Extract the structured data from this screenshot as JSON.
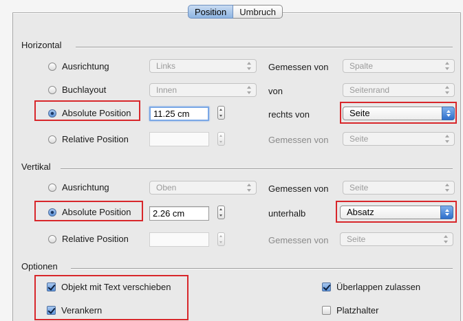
{
  "tabs": [
    {
      "label": "Position",
      "active": true
    },
    {
      "label": "Umbruch",
      "active": false
    }
  ],
  "horizontal": {
    "title": "Horizontal",
    "rows": [
      {
        "radio": "Ausrichtung",
        "selected": false,
        "value": "Links",
        "relation_label": "Gemessen von",
        "relation_value": "Spalte"
      },
      {
        "radio": "Buchlayout",
        "selected": false,
        "value": "Innen",
        "relation_label": "von",
        "relation_value": "Seitenrand"
      },
      {
        "radio": "Absolute Position",
        "selected": true,
        "value": "11.25 cm",
        "relation_label": "rechts von",
        "relation_value": "Seite"
      },
      {
        "radio": "Relative Position",
        "selected": false,
        "value": "",
        "relation_label": "Gemessen von",
        "relation_value": "Seite"
      }
    ]
  },
  "vertikal": {
    "title": "Vertikal",
    "rows": [
      {
        "radio": "Ausrichtung",
        "selected": false,
        "value": "Oben",
        "relation_label": "Gemessen von",
        "relation_value": "Seite"
      },
      {
        "radio": "Absolute Position",
        "selected": true,
        "value": "2.26 cm",
        "relation_label": "unterhalb",
        "relation_value": "Absatz"
      },
      {
        "radio": "Relative Position",
        "selected": false,
        "value": "",
        "relation_label": "Gemessen von",
        "relation_value": "Seite"
      }
    ]
  },
  "optionen": {
    "title": "Optionen",
    "checkboxes": [
      {
        "label": "Objekt mit Text verschieben",
        "checked": true
      },
      {
        "label": "Verankern",
        "checked": true
      },
      {
        "label": "Überlappen zulassen",
        "checked": true
      },
      {
        "label": "Platzhalter",
        "checked": false
      }
    ]
  },
  "colors": {
    "highlight": "#d8262a",
    "accent": "#5c93d9"
  }
}
